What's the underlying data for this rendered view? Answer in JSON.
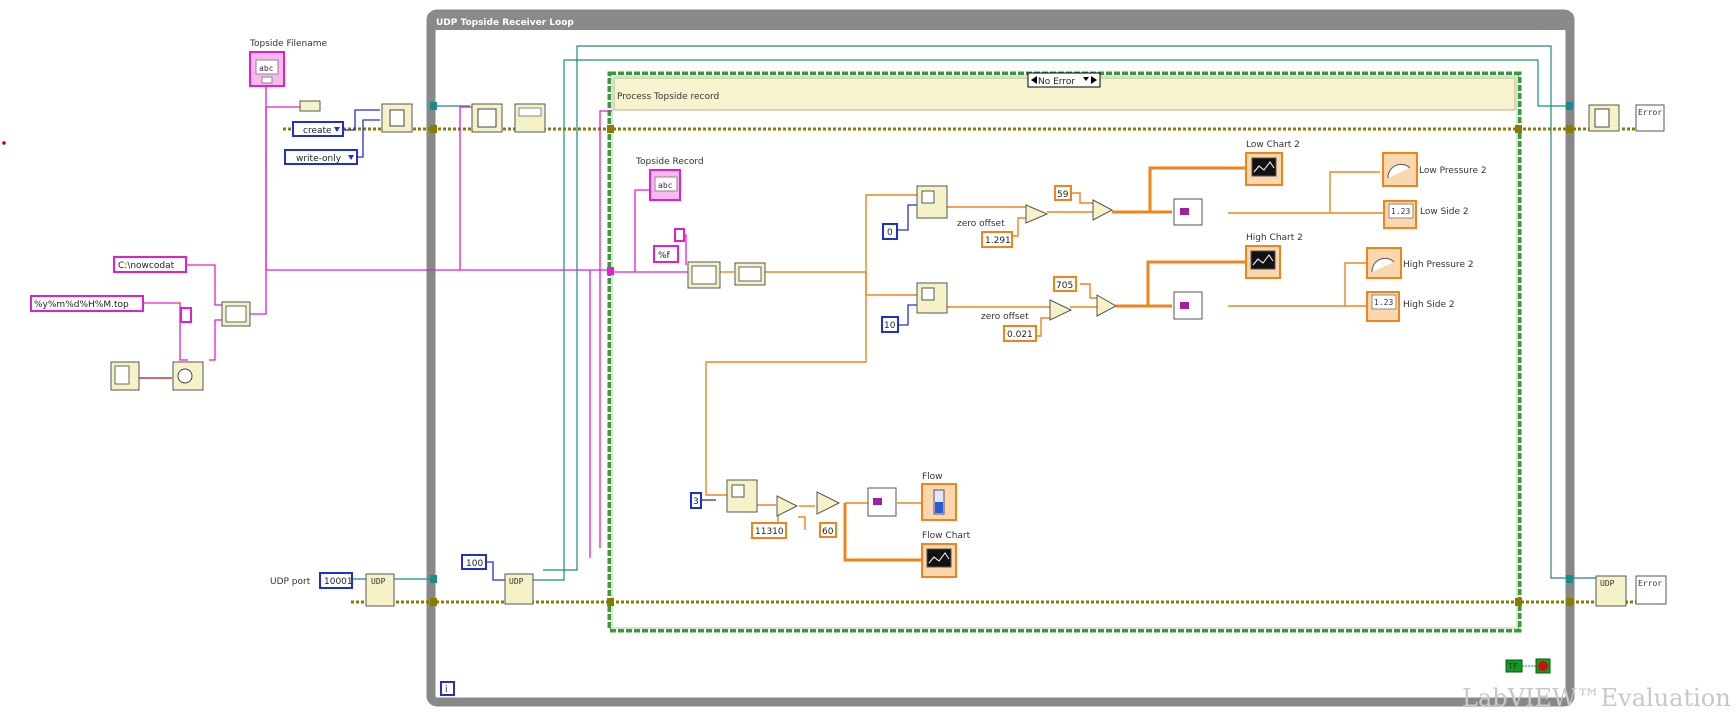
{
  "loop": {
    "title": "UDP Topside Receiver Loop",
    "iteration_terminal": "i"
  },
  "case_structure": {
    "selector": "No Error",
    "subdiagram_label": "Process Topside record"
  },
  "controls": {
    "topside_filename": "Topside Filename",
    "topside_record": "Topside Record",
    "udp_port_label": "UDP port",
    "udp_port_value": "10001"
  },
  "constants": {
    "create": "create",
    "write_only": "write-only",
    "path": "C:\\nowcodat",
    "format": "%y%m%d%H%M.top",
    "timeout": "100",
    "scan_format": "%f",
    "index0": "0",
    "index10": "10",
    "index_flow": "3",
    "low_offset_label": "zero offset",
    "low_offset": "1.291",
    "low_gain": "59",
    "high_offset_label": "zero offset",
    "high_offset": "0.021",
    "high_gain": "705",
    "flow_div": "11310",
    "flow_mult": "60",
    "stop_const": "TF"
  },
  "indicators": {
    "low_chart": "Low Chart 2",
    "low_pressure": "Low Pressure 2",
    "low_side": "Low Side 2",
    "high_chart": "High Chart 2",
    "high_pressure": "High Pressure 2",
    "high_side": "High Side 2",
    "flow": "Flow",
    "flow_chart": "Flow Chart"
  },
  "icon_glyphs": {
    "string_ctl": "abc",
    "numeric": "1.23",
    "udp": "UDP",
    "error": "Error"
  },
  "watermark": "LabVIEW™Evaluation",
  "colors": {
    "loop_gray": "#888888",
    "case_green": "#3a9a3a",
    "wire_orange": "#f0841a",
    "wire_pink": "#e020d0",
    "wire_blue": "#2030d0",
    "wire_teal": "#1a8a8a",
    "error_wire": "#9a8a00",
    "node_fill": "#f5f2c8"
  }
}
